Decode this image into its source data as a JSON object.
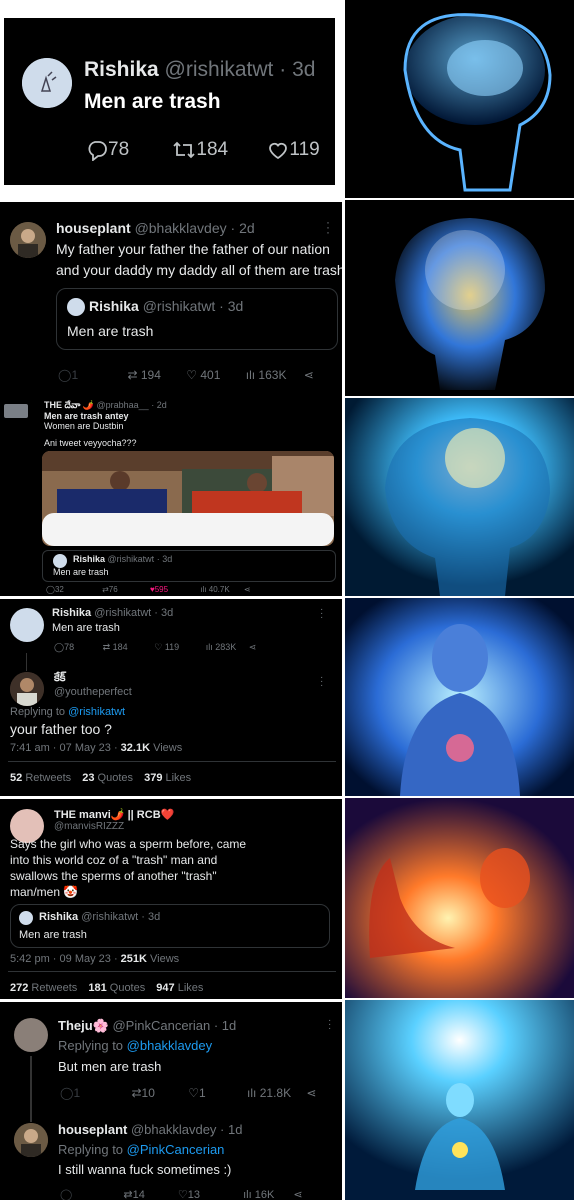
{
  "p1": {
    "name": "Rishika",
    "handle": "@rishikatwt",
    "time": "3d",
    "text": "Men are trash",
    "replies": "78",
    "retweets": "184",
    "likes": "119"
  },
  "p2": {
    "name": "houseplant",
    "handle": "@bhakklavdey",
    "time": "2d",
    "text1": "My father your father the father of our nation",
    "text2": "and your daddy my daddy all of them are trash",
    "q_name": "Rishika",
    "q_handle": "@rishikatwt",
    "q_time": "3d",
    "q_text": "Men are trash",
    "replies": "1",
    "retweets": "194",
    "likes": "401",
    "views": "163K"
  },
  "p3": {
    "name": "THE దేవా 🌶️",
    "handle": "@prabhaa__",
    "time": "2d",
    "text1": "Men are trash antey",
    "text2": "Women are Dustbin",
    "text3": "Ani tweet veyyocha???",
    "q_name": "Rishika",
    "q_handle": "@rishikatwt",
    "q_time": "3d",
    "q_text": "Men are trash",
    "replies": "32",
    "retweets": "76",
    "likes": "595",
    "views": "40.7K"
  },
  "p4": {
    "name": "Rishika",
    "handle": "@rishikatwt",
    "time": "3d",
    "text": "Men are trash",
    "replies": "78",
    "retweets": "184",
    "likes": "119",
    "views": "283K",
    "r_name": "కేక్",
    "r_handle": "@youtheperfect",
    "replying_prefix": "Replying to",
    "replying_to": "@rishikatwt",
    "r_text": "your father too ?",
    "r_time": "7:41 am · 07 May 23 ·",
    "r_views_num": "32.1K",
    "r_views_label": "Views",
    "s1_num": "52",
    "s1_label": "Retweets",
    "s2_num": "23",
    "s2_label": "Quotes",
    "s3_num": "379",
    "s3_label": "Likes"
  },
  "p5": {
    "name": "THE manvi🌶️ || RCB❤️",
    "handle": "@manvisRIZZZ",
    "line1": "Says the girl who was a sperm before, came",
    "line2": "into this world coz of a \"trash\" man and",
    "line3": "swallows the sperms of another \"trash\"",
    "line4": "man/men 🤡",
    "q_name": "Rishika",
    "q_handle": "@rishikatwt",
    "q_time": "3d",
    "q_text": "Men are trash",
    "time": "5:42 pm · 09 May 23 ·",
    "views_num": "251K",
    "views_label": "Views",
    "s1_num": "272",
    "s1_label": "Retweets",
    "s2_num": "181",
    "s2_label": "Quotes",
    "s3_num": "947",
    "s3_label": "Likes"
  },
  "p6": {
    "name": "Theju🌸",
    "handle": "@PinkCancerian",
    "time": "1d",
    "replying_prefix": "Replying to",
    "replying_to": "@bhakklavdey",
    "text": "But men are trash",
    "replies": "1",
    "retweets": "10",
    "likes": "1",
    "views": "21.8K",
    "r_name": "houseplant",
    "r_handle": "@bhakklavdey",
    "r_time": "1d",
    "r_replying_to": "@PinkCancerian",
    "r_text": "I still wanna fuck sometimes :)",
    "r_replies": "",
    "r_retweets": "14",
    "r_likes": "13",
    "r_views": "16K"
  },
  "colors": {
    "bg": "#000000",
    "text": "#e7e9ea",
    "muted": "#71767b",
    "link": "#1d9bf0",
    "like_active": "#f91880"
  }
}
